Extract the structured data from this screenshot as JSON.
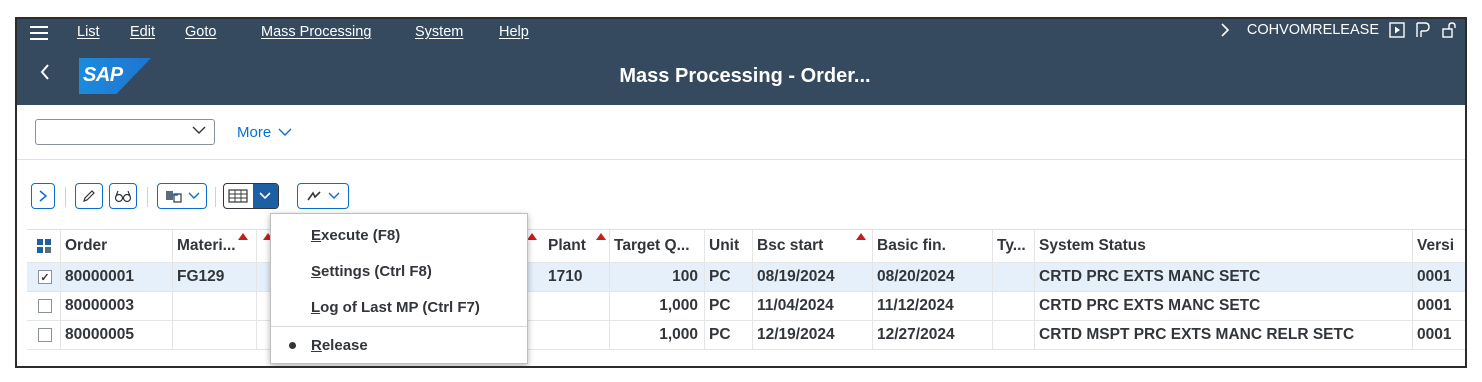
{
  "menubar": {
    "items": [
      "List",
      "Edit",
      "Goto",
      "Mass Processing",
      "System",
      "Help"
    ],
    "tcode": "COHVOMRELEASE"
  },
  "titlebar": {
    "logo": "SAP",
    "title": "Mass Processing - Order..."
  },
  "selection": {
    "variant_value": "",
    "more_label": "More"
  },
  "table": {
    "columns": [
      "Order",
      "Materi...",
      "Plant",
      "Target Q...",
      "Unit",
      "Bsc start",
      "Basic fin.",
      "Ty...",
      "System Status",
      "Versi"
    ],
    "rows": [
      {
        "selected": true,
        "order": "80000001",
        "material": "FG129",
        "plant": "1710",
        "target_qty": "100",
        "unit": "PC",
        "bsc_start": "08/19/2024",
        "basic_fin": "08/20/2024",
        "type": "",
        "system_status": "CRTD PRC  EXTS MANC SETC",
        "version": "0001"
      },
      {
        "selected": false,
        "order": "80000003",
        "material": "",
        "plant": "",
        "target_qty": "1,000",
        "unit": "PC",
        "bsc_start": "11/04/2024",
        "basic_fin": "11/12/2024",
        "type": "",
        "system_status": "CRTD PRC  EXTS MANC SETC",
        "version": "0001"
      },
      {
        "selected": false,
        "order": "80000005",
        "material": "",
        "plant": "",
        "target_qty": "1,000",
        "unit": "PC",
        "bsc_start": "12/19/2024",
        "basic_fin": "12/27/2024",
        "type": "",
        "system_status": "CRTD MSPT PRC  EXTS MANC RELR SETC",
        "version": "0001"
      }
    ]
  },
  "dropdown": {
    "items": [
      {
        "label": "Execute (F8)",
        "mnemonic": "E",
        "rest": "xecute (F8)"
      },
      {
        "label": "Settings (Ctrl F8)",
        "mnemonic": "S",
        "rest": "ettings (Ctrl F8)"
      },
      {
        "label": "Log of Last MP (Ctrl F7)",
        "mnemonic": "L",
        "rest": "og of Last MP (Ctrl F7)"
      },
      {
        "label": "Release",
        "mnemonic": "R",
        "rest": "elease",
        "selected": true
      }
    ]
  },
  "colors": {
    "shell": "#354a5f",
    "accent": "#0a6ed1",
    "sort_marker": "#c41e1e",
    "selected_row": "#e5f0fa"
  },
  "icons": [
    "menu-icon",
    "back-icon",
    "expand-icon",
    "edit-pencil-icon",
    "display-glasses-icon",
    "transfer-icon",
    "mass-processing-icon",
    "chevron-down-icon",
    "action-icon",
    "play-icon",
    "layout-icon",
    "lock-icon"
  ]
}
